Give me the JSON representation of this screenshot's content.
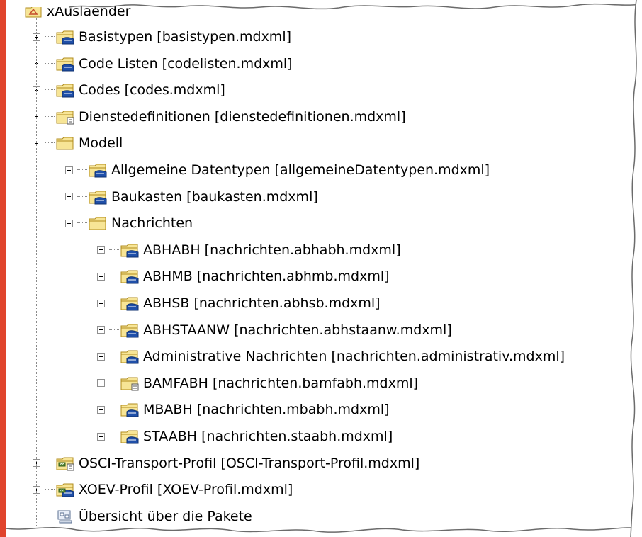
{
  "tree": {
    "root": {
      "label": "xAuslaender",
      "icon": "model-root-icon"
    },
    "items": [
      {
        "label": "Basistypen [basistypen.mdxml]",
        "level": 1,
        "expanded": false,
        "icon": "shared-package-icon"
      },
      {
        "label": "Code Listen [codelisten.mdxml]",
        "level": 1,
        "expanded": false,
        "icon": "shared-package-icon"
      },
      {
        "label": "Codes [codes.mdxml]",
        "level": 1,
        "expanded": false,
        "icon": "shared-package-icon"
      },
      {
        "label": "Dienstedefinitionen [dienstedefinitionen.mdxml]",
        "level": 1,
        "expanded": false,
        "icon": "readonly-package-icon"
      },
      {
        "label": "Modell",
        "level": 1,
        "expanded": true,
        "icon": "package-icon"
      },
      {
        "label": "Allgemeine Datentypen [allgemeineDatentypen.mdxml]",
        "level": 2,
        "expanded": false,
        "icon": "shared-package-icon"
      },
      {
        "label": "Baukasten [baukasten.mdxml]",
        "level": 2,
        "expanded": false,
        "icon": "shared-package-icon"
      },
      {
        "label": "Nachrichten",
        "level": 2,
        "expanded": true,
        "icon": "package-icon"
      },
      {
        "label": "ABHABH [nachrichten.abhabh.mdxml]",
        "level": 3,
        "expanded": false,
        "icon": "shared-package-icon"
      },
      {
        "label": "ABHMB [nachrichten.abhmb.mdxml]",
        "level": 3,
        "expanded": false,
        "icon": "shared-package-icon"
      },
      {
        "label": "ABHSB [nachrichten.abhsb.mdxml]",
        "level": 3,
        "expanded": false,
        "icon": "shared-package-icon"
      },
      {
        "label": "ABHSTAANW [nachrichten.abhstaanw.mdxml]",
        "level": 3,
        "expanded": false,
        "icon": "shared-package-icon"
      },
      {
        "label": "Administrative Nachrichten [nachrichten.administrativ.mdxml]",
        "level": 3,
        "expanded": false,
        "icon": "shared-package-icon"
      },
      {
        "label": "BAMFABH [nachrichten.bamfabh.mdxml]",
        "level": 3,
        "expanded": false,
        "icon": "readonly-package-icon"
      },
      {
        "label": "MBABH [nachrichten.mbabh.mdxml]",
        "level": 3,
        "expanded": false,
        "icon": "shared-package-icon"
      },
      {
        "label": "STAABH [nachrichten.staabh.mdxml]",
        "level": 3,
        "expanded": false,
        "icon": "shared-package-icon"
      },
      {
        "label": "OSCI-Transport-Profil [OSCI-Transport-Profil.mdxml]",
        "level": 1,
        "expanded": false,
        "icon": "profile-readonly-icon"
      },
      {
        "label": "XOEV-Profil [XOEV-Profil.mdxml]",
        "level": 1,
        "expanded": false,
        "icon": "profile-shared-icon"
      },
      {
        "label": "Übersicht über die Pakete",
        "level": 1,
        "expanded": null,
        "icon": "diagram-icon"
      }
    ]
  },
  "colors": {
    "folder_fill": "#f7e596",
    "folder_stroke": "#b08c1c",
    "shared_hand": "#1f4fa8",
    "red_edge": "#e0442c"
  }
}
